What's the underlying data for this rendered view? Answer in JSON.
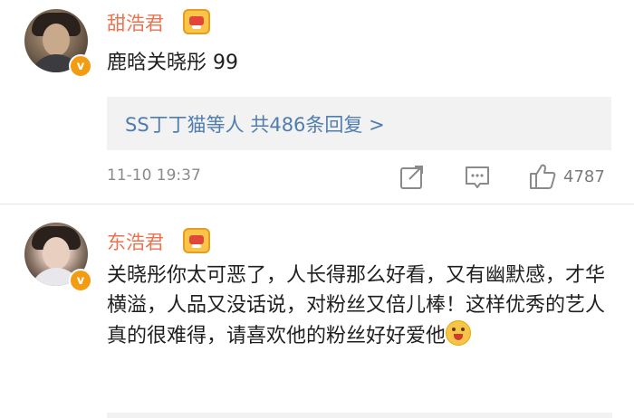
{
  "comments": [
    {
      "username": "甜浩君",
      "text": "鹿晗关晓彤 99",
      "reply_summary": "SS丁丁猫等人  共486条回复 >",
      "timestamp": "11-10 19:37",
      "like_count": "4787"
    },
    {
      "username": "东浩君",
      "text": "关晓彤你太可恶了，人长得那么好看，又有幽默感，才华横溢，人品又没话说，对粉丝又倍儿棒！这样优秀的艺人真的很难得，请喜欢他的粉丝好好爱他"
    }
  ],
  "badges": {
    "verified_symbol": "v"
  },
  "colors": {
    "username": "#eb7350",
    "link": "#507daf",
    "meta": "#8a8a8a",
    "reply_bg": "#f2f2f2",
    "badge": "#f39c12"
  }
}
